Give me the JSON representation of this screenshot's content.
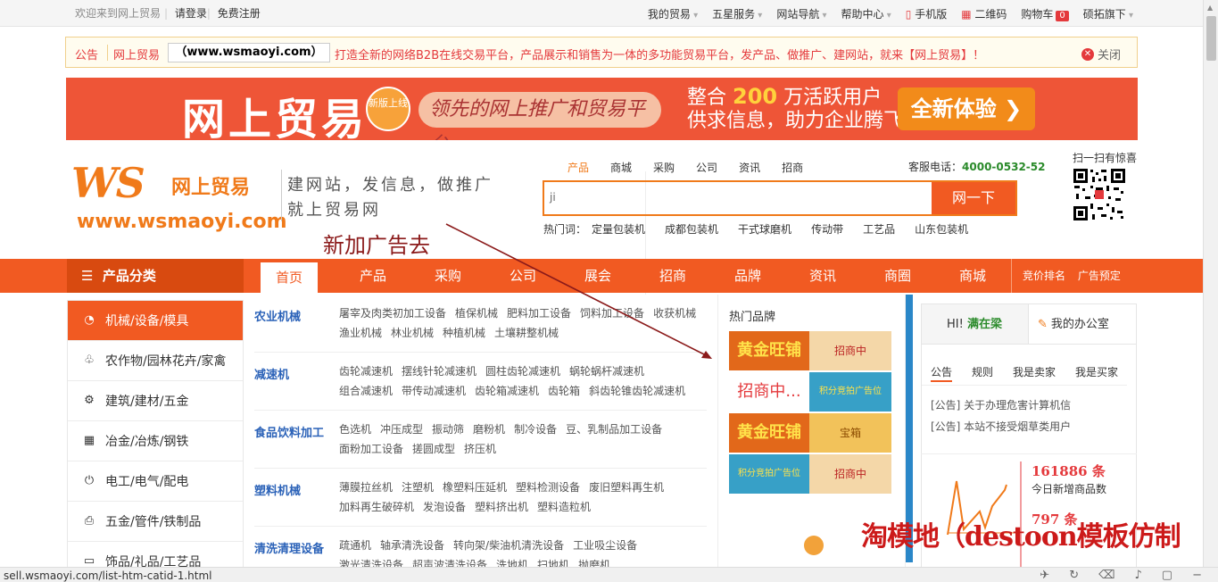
{
  "topbar": {
    "welcome": "欢迎来到网上贸易",
    "login": "请登录",
    "register": "免费注册",
    "links": [
      "我的贸易",
      "五星服务",
      "网站导航",
      "帮助中心",
      "手机版",
      "二维码",
      "购物车",
      "硕拓旗下"
    ],
    "cart_count": "0"
  },
  "notice": {
    "label": "公告",
    "site": "网上贸易",
    "url": "（www.wsmaoyi.com）",
    "message": "打造全新的网络B2B在线交易平台，产品展示和销售为一体的多功能贸易平台，发产品、做推广、建网站，就来【网上贸易】！",
    "close": "关闭"
  },
  "banner": {
    "title": "网上贸易",
    "badge": "新版上线",
    "pill": "领先的网上推广和贸易平台",
    "line1_pre": "整合",
    "line1_num": "200",
    "line1_post": "万活跃用户",
    "line2": "供求信息，助力企业腾飞",
    "cta": "全新体验"
  },
  "logo": {
    "big": "WS",
    "sub": "网上贸易",
    "url": "www.wsmaoyi.com"
  },
  "slogan": {
    "line1": "建网站，发信息，做推广",
    "line2": "就上贸易网"
  },
  "ad_note": "新加广告去",
  "search": {
    "tabs": [
      "产品",
      "商城",
      "采购",
      "公司",
      "资讯",
      "招商"
    ],
    "value": "ji",
    "button": "网一下",
    "hot_label": "热门词：",
    "hot_words": [
      "定量包装机",
      "成都包装机",
      "干式球磨机",
      "传动带",
      "工艺品",
      "山东包装机"
    ],
    "phone_label": "客服电话：",
    "phone": "4000-0532-52",
    "qr_label": "扫一扫有惊喜"
  },
  "nav": {
    "category": "产品分类",
    "items": [
      "首页",
      "产品",
      "采购",
      "公司",
      "展会",
      "招商",
      "品牌",
      "资讯",
      "商圈",
      "商城"
    ],
    "right": [
      "竞价排名",
      "广告预定"
    ]
  },
  "sidebar": {
    "items": [
      {
        "label": "机械/设备/模具",
        "icon": "◔"
      },
      {
        "label": "农作物/园林花卉/家禽",
        "icon": "♧"
      },
      {
        "label": "建筑/建材/五金",
        "icon": "⚙"
      },
      {
        "label": "冶金/冶炼/钢铁",
        "icon": "▦"
      },
      {
        "label": "电工/电气/配电",
        "icon": "⏻"
      },
      {
        "label": "五金/管件/铁制品",
        "icon": "⎙"
      },
      {
        "label": "饰品/礼品/工艺品",
        "icon": "▭"
      }
    ]
  },
  "subcats": [
    {
      "title": "农业机械",
      "items": [
        "屠宰及肉类初加工设备",
        "植保机械",
        "肥料加工设备",
        "饲料加工设备",
        "收获机械",
        "渔业机械",
        "林业机械",
        "种植机械",
        "土壤耕整机械"
      ]
    },
    {
      "title": "减速机",
      "items": [
        "齿轮减速机",
        "摆线针轮减速机",
        "圆柱齿轮减速机",
        "蜗轮蜗杆减速机",
        "组合减速机",
        "带传动减速机",
        "齿轮箱减速机",
        "齿轮箱",
        "斜齿轮锥齿轮减速机"
      ]
    },
    {
      "title": "食品饮料加工",
      "items": [
        "色选机",
        "冲压成型",
        "振动筛",
        "磨粉机",
        "制冷设备",
        "豆、乳制品加工设备",
        "面粉加工设备",
        "搓圆成型",
        "挤压机"
      ]
    },
    {
      "title": "塑料机械",
      "items": [
        "薄膜拉丝机",
        "注塑机",
        "橡塑料压延机",
        "塑料检测设备",
        "废旧塑料再生机",
        "加料再生破碎机",
        "发泡设备",
        "塑料挤出机",
        "塑料造粒机"
      ]
    },
    {
      "title": "清洗清理设备",
      "items": [
        "疏通机",
        "轴承清洗设备",
        "转向架/柴油机清洗设备",
        "工业吸尘设备",
        "激光清洗设备",
        "超声波清洗设备",
        "洗地机",
        "扫地机",
        "抛磨机"
      ]
    }
  ],
  "brands": {
    "title": "热门品牌",
    "items": [
      {
        "left": "黄金旺铺",
        "right": "招商中"
      },
      {
        "left": "招商中...",
        "right": "积分竞拍广告位"
      },
      {
        "left": "黄金旺铺",
        "right": "宝箱"
      },
      {
        "left": "积分竞拍广告位",
        "right": "招商中"
      }
    ]
  },
  "user": {
    "hi": "HI!",
    "name": "满在梁",
    "office": "我的办公室",
    "tabs": [
      "公告",
      "规则",
      "我是卖家",
      "我是买家"
    ],
    "notices": [
      "[公告] 关于办理危害计算机信",
      "[公告] 本站不接受烟草类用户"
    ]
  },
  "stats": {
    "n1": "161886 条",
    "l1": "今日新增商品数",
    "n2": "797 条"
  },
  "watermark": "淘模地（destoon模板仿制",
  "status_url": "sell.wsmaoyi.com/list-htm-catid-1.html",
  "colors": {
    "accent": "#f15a22",
    "link": "#2b62b8",
    "alert": "#e4393c"
  }
}
